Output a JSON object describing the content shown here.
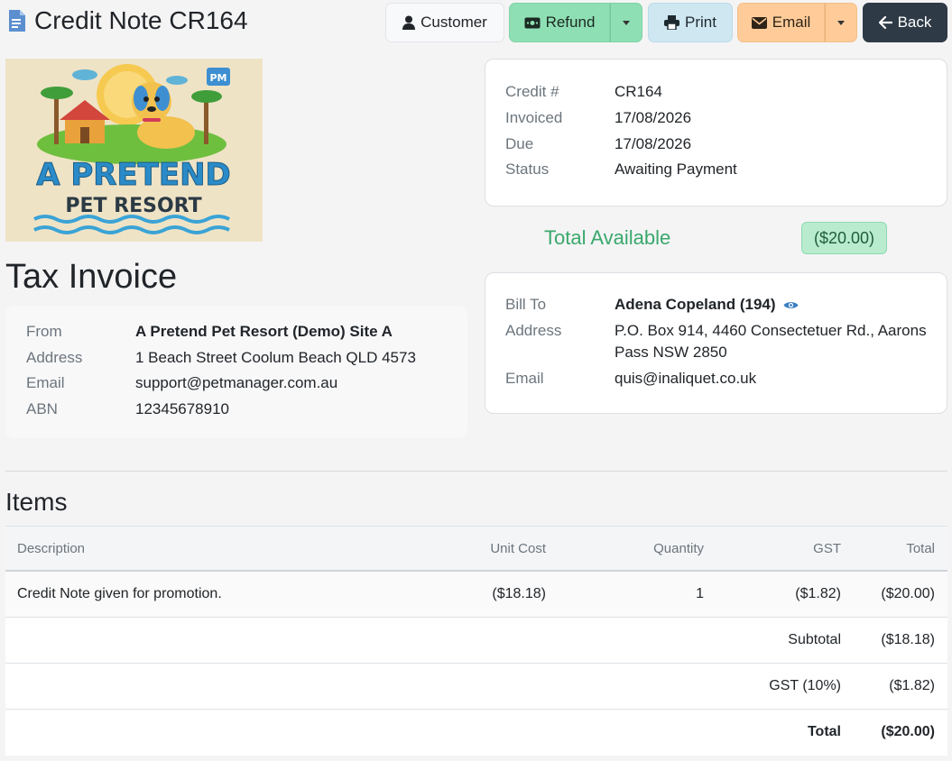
{
  "header": {
    "title": "Credit Note CR164",
    "buttons": {
      "customer": "Customer",
      "refund": "Refund",
      "print": "Print",
      "email": "Email",
      "back": "Back"
    }
  },
  "logo": {
    "line1": "A PRETEND",
    "line2": "PET RESORT",
    "badge": "PM"
  },
  "tax_title": "Tax Invoice",
  "from": {
    "rows": [
      {
        "label": "From",
        "value": "A Pretend Pet Resort (Demo) Site A"
      },
      {
        "label": "Address",
        "value": "1 Beach Street Coolum Beach QLD 4573"
      },
      {
        "label": "Email",
        "value": "support@petmanager.com.au"
      },
      {
        "label": "ABN",
        "value": "12345678910"
      }
    ]
  },
  "credit": {
    "rows": [
      {
        "label": "Credit #",
        "value": "CR164"
      },
      {
        "label": "Invoiced",
        "value": "17/08/2026"
      },
      {
        "label": "Due",
        "value": "17/08/2026"
      },
      {
        "label": "Status",
        "value": "Awaiting Payment"
      }
    ]
  },
  "total_available": {
    "label": "Total Available",
    "value": "($20.00)"
  },
  "bill": {
    "rows": [
      {
        "label": "Bill To",
        "value": "Adena Copeland (194)"
      },
      {
        "label": "Address",
        "value": "P.O. Box 914, 4460 Consectetuer Rd., Aarons Pass NSW 2850"
      },
      {
        "label": "Email",
        "value": "quis@inaliquet.co.uk"
      }
    ]
  },
  "items": {
    "title": "Items",
    "columns": [
      "Description",
      "Unit Cost",
      "Quantity",
      "GST",
      "Total"
    ],
    "rows": [
      {
        "description": "Credit Note given for promotion.",
        "unit_cost": "($18.18)",
        "quantity": "1",
        "gst": "($1.82)",
        "total": "($20.00)"
      }
    ],
    "summary": [
      {
        "label": "Subtotal",
        "value": "($18.18)"
      },
      {
        "label": "GST (10%)",
        "value": "($1.82)"
      },
      {
        "label": "Total",
        "value": "($20.00)"
      }
    ]
  },
  "colors": {
    "refund": "#8fdfb4",
    "print": "#cfe7f1",
    "email": "#ffcc99",
    "back": "#2e3a46",
    "total_available": "#3aa86b"
  }
}
